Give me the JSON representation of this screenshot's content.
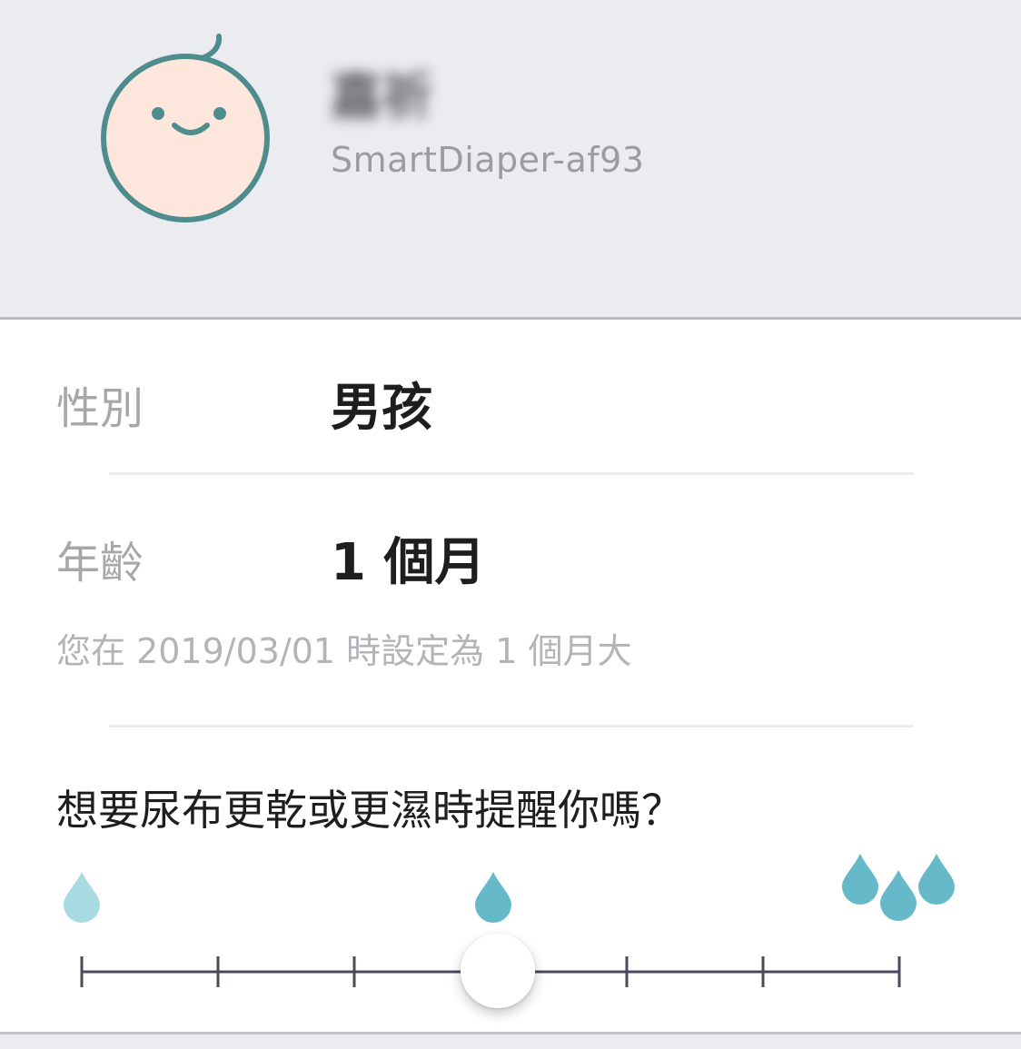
{
  "profile": {
    "name": "嘉祈",
    "device_id": "SmartDiaper-af93"
  },
  "gender": {
    "label": "性別",
    "value": "男孩"
  },
  "age": {
    "label": "年齡",
    "value": "1 個月",
    "note": "您在 2019/03/01 時設定為 1 個月大"
  },
  "reminder": {
    "question": "想要尿布更乾或更濕時提醒你嗎？",
    "slider": {
      "steps": 7,
      "selected_step": 4,
      "level_icons": [
        "single-drop-light-icon",
        "single-drop-icon",
        "three-drops-icon"
      ]
    }
  },
  "colors": {
    "header_bg": "#eaecef",
    "avatar_stroke": "#4f8c8e",
    "avatar_fill": "#fde7dc",
    "drop_light": "#a9dbe3",
    "drop": "#65b9c8",
    "track": "#4a4a5a"
  }
}
